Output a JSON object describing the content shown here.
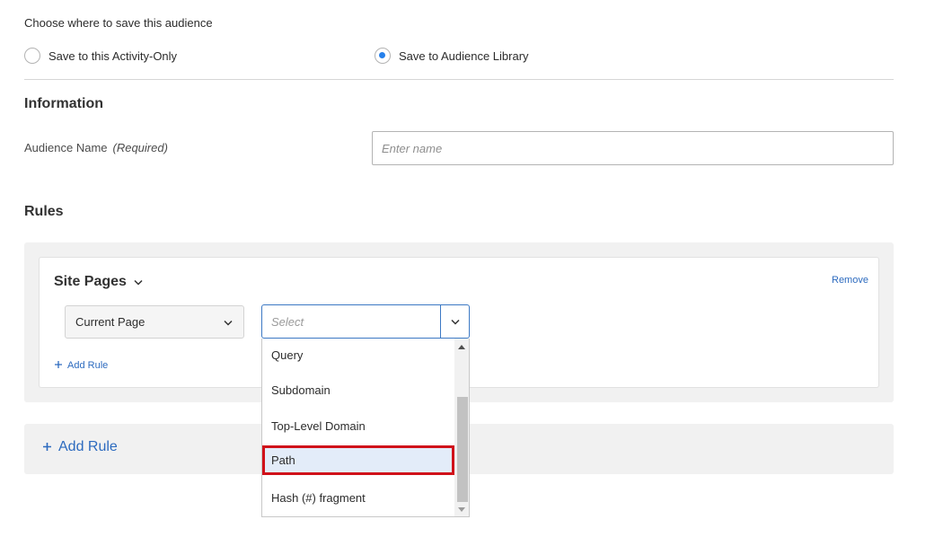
{
  "save_section": {
    "prompt": "Choose where to save this audience",
    "options": [
      {
        "label": "Save to this Activity-Only",
        "selected": false
      },
      {
        "label": "Save to Audience Library",
        "selected": true
      }
    ]
  },
  "information": {
    "heading": "Information",
    "audience_name_label": "Audience Name",
    "required_note": "(Required)",
    "name_placeholder": "Enter name",
    "name_value": ""
  },
  "rules": {
    "heading": "Rules",
    "card": {
      "title": "Site Pages",
      "remove_label": "Remove",
      "current_page_value": "Current Page",
      "select_placeholder": "Select",
      "add_rule_label": "Add Rule"
    },
    "dropdown_options": [
      {
        "label": "Query",
        "highlighted": false
      },
      {
        "label": "Subdomain",
        "highlighted": false
      },
      {
        "label": "Top-Level Domain",
        "highlighted": false
      },
      {
        "label": "Path",
        "highlighted": true
      },
      {
        "label": "Hash (#) fragment",
        "highlighted": false
      }
    ],
    "add_rule_big_label": "Add Rule"
  },
  "colors": {
    "accent": "#2680eb",
    "link": "#2d6bbf",
    "highlight_border": "#d0111a",
    "highlight_fill": "#e3ecf9",
    "panel": "#f1f1f1"
  },
  "icons": {
    "site_pages_chevron": "chevron-down-icon",
    "current_page_chevron": "chevron-down-icon",
    "select_chevron": "chevron-down-icon",
    "add_rule": "plus-icon",
    "scroll_up": "caret-up-icon",
    "scroll_down": "caret-down-icon"
  }
}
